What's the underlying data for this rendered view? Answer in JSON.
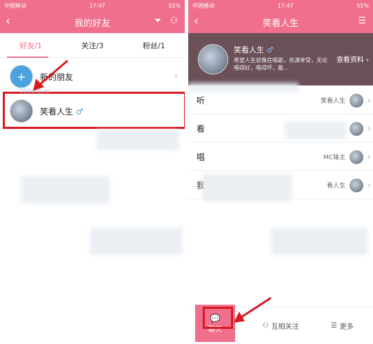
{
  "colors": {
    "accent": "#f06f8c",
    "annotation": "#d71921"
  },
  "left": {
    "status": {
      "carrier": "中国移动",
      "time": "17:47",
      "battery": "55%"
    },
    "header": {
      "title": "我的好友",
      "back_icon": "chevron-left-icon",
      "filter_icon": "filter-icon",
      "add_icon": "add-user-icon"
    },
    "tabs": [
      {
        "label": "好友/1"
      },
      {
        "label": "关注/3"
      },
      {
        "label": "粉丝/1"
      }
    ],
    "new_friends": {
      "label": "新的朋友"
    },
    "friend": {
      "name": "笑看人生",
      "gender_icon": "♂"
    },
    "watermark": "3533.com"
  },
  "right": {
    "status": {
      "carrier": "中国移动",
      "time": "17:47",
      "battery": "55%"
    },
    "header": {
      "title": "笑看人生",
      "back_icon": "chevron-left-icon",
      "menu_icon": "menu-icon"
    },
    "profile": {
      "name": "笑看人生",
      "gender_icon": "♂",
      "desc": "希望人生就像在唱歌，充满享受，无论唱得好，唱得坏，最…",
      "view_label": "查看资料"
    },
    "feed": [
      {
        "letter": "听",
        "user": "笑看人生"
      },
      {
        "letter": "看",
        "user": ""
      },
      {
        "letter": "唱",
        "user": "MC锋主"
      },
      {
        "letter": "我",
        "user": "看人生"
      }
    ],
    "bottom": {
      "chat": "聊天",
      "follow": "互相关注",
      "more": "更多"
    }
  }
}
